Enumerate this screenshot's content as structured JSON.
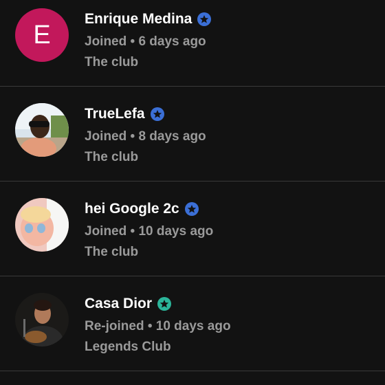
{
  "colors": {
    "background": "#121212",
    "name_text": "#ffffff",
    "secondary_text": "#9a9a9a",
    "divider": "#3a3a3a",
    "badge_blue": "#3b6fd6",
    "badge_teal": "#2bb59a",
    "initial_avatar_bg": "#c2185b"
  },
  "members": [
    {
      "name": "Enrique Medina",
      "avatar_initial": "E",
      "badge_icon": "star-badge-icon",
      "badge_color": "#3b6fd6",
      "status": "Joined • 6 days ago",
      "club": "The club"
    },
    {
      "name": "TrueLefa",
      "avatar_icon": "profile-photo",
      "badge_icon": "star-badge-icon",
      "badge_color": "#3b6fd6",
      "status": "Joined • 8 days ago",
      "club": "The club"
    },
    {
      "name": "hei Google 2c",
      "avatar_icon": "profile-photo",
      "badge_icon": "star-badge-icon",
      "badge_color": "#3b6fd6",
      "status": "Joined • 10 days ago",
      "club": "The club"
    },
    {
      "name": "Casa Dior",
      "avatar_icon": "profile-photo",
      "badge_icon": "star-badge-icon",
      "badge_color": "#2bb59a",
      "status": "Re-joined • 10 days ago",
      "club": "Legends Club"
    }
  ]
}
